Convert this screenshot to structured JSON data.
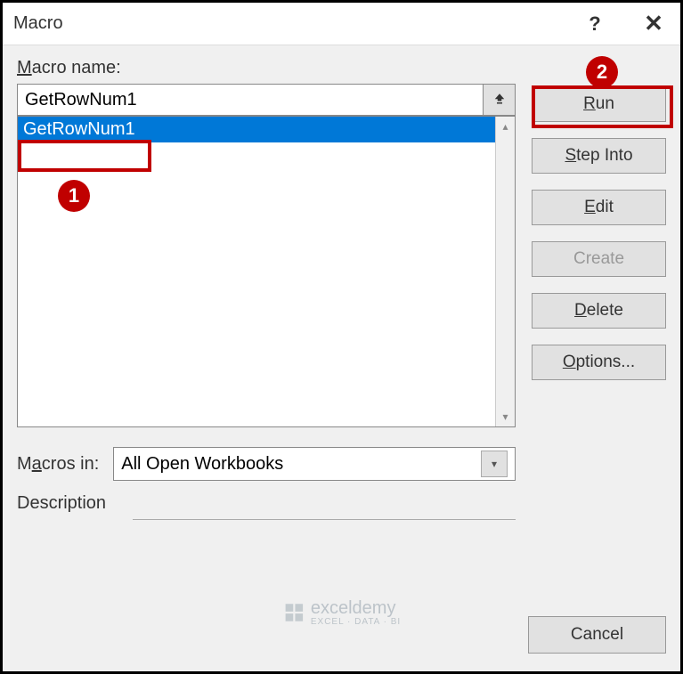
{
  "title": "Macro",
  "labels": {
    "macroName": "Macro name:",
    "macrosIn": "Macros in:",
    "description": "Description"
  },
  "macroNameInput": "GetRowNum1",
  "macroList": {
    "items": [
      "GetRowNum1"
    ],
    "selected": 0
  },
  "macrosInDropdown": {
    "selected": "All Open Workbooks"
  },
  "buttons": {
    "run": "Run",
    "stepInto": "Step Into",
    "edit": "Edit",
    "create": "Create",
    "delete": "Delete",
    "options": "Options...",
    "cancel": "Cancel"
  },
  "callouts": {
    "one": "1",
    "two": "2"
  },
  "watermark": {
    "name": "exceldemy",
    "sub": "EXCEL · DATA · BI"
  }
}
